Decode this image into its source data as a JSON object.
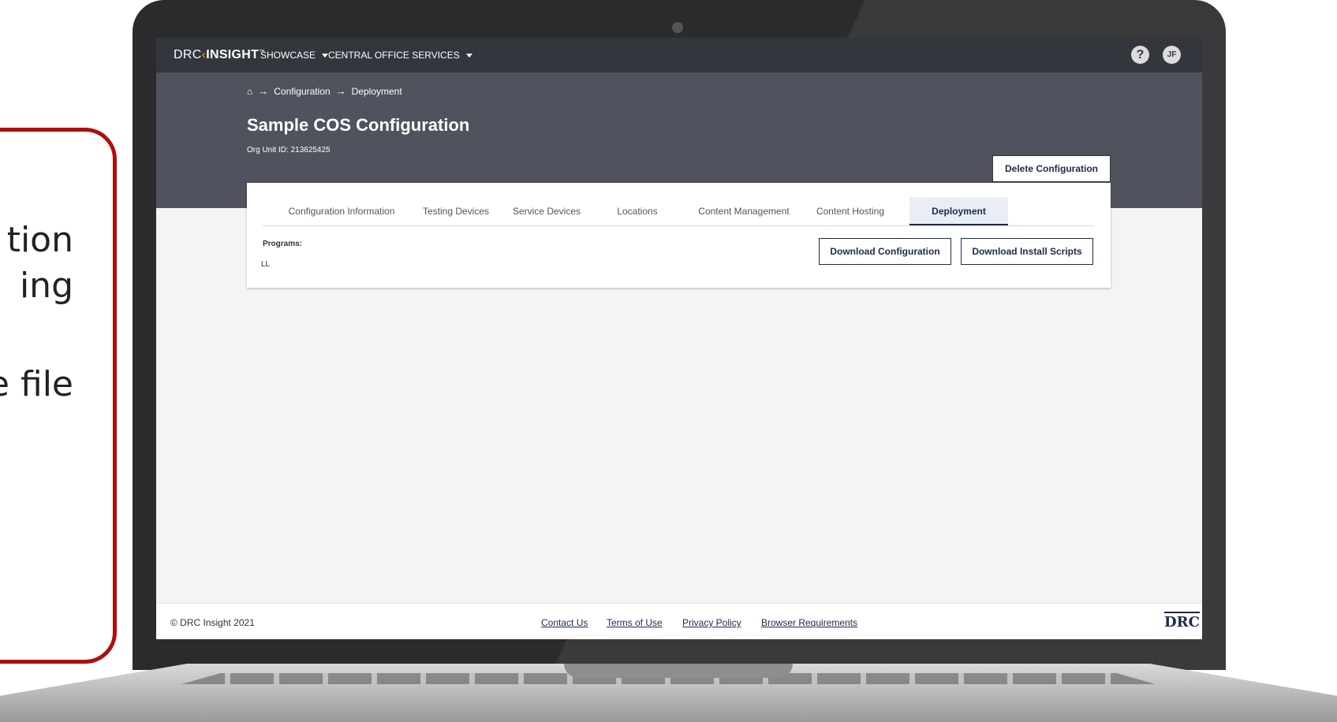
{
  "callout": {
    "lines": [
      "tion",
      "ing",
      "e file"
    ]
  },
  "topnav": {
    "logo_prefix": "DRC",
    "logo_arrow": "‹",
    "logo_main": "INSIGHT",
    "logo_tm": "™",
    "menu_showcase": "SHOWCASE",
    "menu_cos": "CENTRAL OFFICE SERVICES",
    "help_label": "?",
    "avatar_initials": "JF"
  },
  "breadcrumb": {
    "home_icon": "home-icon",
    "items": [
      "Configuration",
      "Deployment"
    ]
  },
  "header": {
    "title": "Sample COS Configuration",
    "org_unit": "Org Unit ID: 213625425",
    "delete_label": "Delete Configuration"
  },
  "tabs": [
    {
      "label": "Configuration Information"
    },
    {
      "label": "Testing Devices"
    },
    {
      "label": "Service Devices"
    },
    {
      "label": "Locations"
    },
    {
      "label": "Content Management"
    },
    {
      "label": "Content Hosting"
    },
    {
      "label": "Deployment",
      "active": true
    }
  ],
  "deployment": {
    "programs_label": "Programs:",
    "programs_value": "LL",
    "download_config_label": "Download Configuration",
    "download_scripts_label": "Download Install Scripts"
  },
  "footer": {
    "copyright": "© DRC Insight 2021",
    "links": [
      "Contact Us",
      "Terms of Use",
      "Privacy Policy",
      "Browser Requirements"
    ],
    "logo_text": "DRC"
  },
  "colors": {
    "callout_border": "#b00d0d",
    "nav_bg": "#34363e",
    "header_bg": "#50535d",
    "accent_navy": "#1c2a4a",
    "logo_accent": "#f39c12"
  }
}
